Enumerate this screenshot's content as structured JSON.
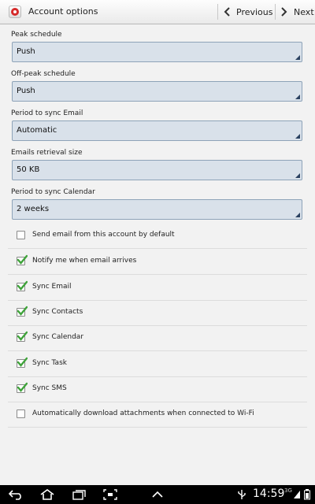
{
  "header": {
    "title": "Account options",
    "previous_label": "Previous",
    "next_label": "Next"
  },
  "spinners": [
    {
      "label": "Peak schedule",
      "value": "Push"
    },
    {
      "label": "Off-peak schedule",
      "value": "Push"
    },
    {
      "label": "Period to sync Email",
      "value": "Automatic"
    },
    {
      "label": "Emails retrieval size",
      "value": "50 KB"
    },
    {
      "label": "Period to sync Calendar",
      "value": "2 weeks"
    }
  ],
  "checkboxes": [
    {
      "label": "Send email from this account by default",
      "checked": false
    },
    {
      "label": "Notify me when email arrives",
      "checked": true
    },
    {
      "label": "Sync Email",
      "checked": true
    },
    {
      "label": "Sync Contacts",
      "checked": true
    },
    {
      "label": "Sync Calendar",
      "checked": true
    },
    {
      "label": "Sync Task",
      "checked": true
    },
    {
      "label": "Sync SMS",
      "checked": true
    },
    {
      "label": "Automatically download attachments when connected to Wi-Fi",
      "checked": false
    }
  ],
  "statusbar": {
    "time": "14:59",
    "network": "3G"
  },
  "colors": {
    "spinner_bg": "#d9e1ea",
    "spinner_border": "#8ea3b8",
    "check_green": "#3fa33a",
    "statusbar_bg": "#000000"
  }
}
